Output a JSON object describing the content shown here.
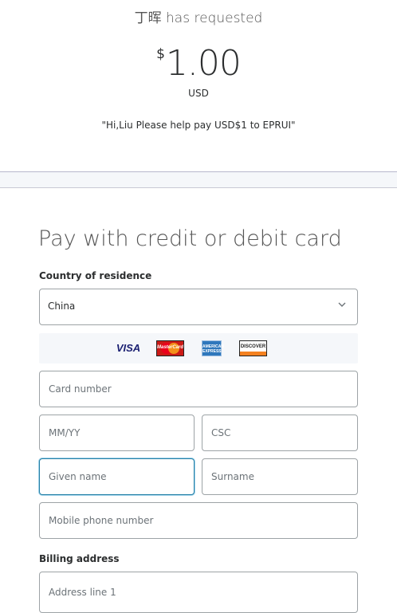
{
  "header": {
    "requester_text": "丁晖 has requested",
    "currency_symbol": "$",
    "amount": "1.00",
    "currency_code": "USD",
    "note": "\"Hi,Liu Please help pay USD$1 to EPRUI\""
  },
  "form": {
    "title": "Pay with credit or debit card",
    "country_label": "Country of residence",
    "country_value": "China",
    "card_brands": [
      "VISA",
      "MasterCard",
      "American Express",
      "DISCOVER"
    ],
    "card_number_placeholder": "Card number",
    "expiry_placeholder": "MM/YY",
    "csc_placeholder": "CSC",
    "given_name_placeholder": "Given name",
    "surname_placeholder": "Surname",
    "phone_placeholder": "Mobile phone number",
    "billing_label": "Billing address",
    "address_line1_placeholder": "Address line 1"
  },
  "colors": {
    "focus_border": "#2580a6",
    "divider_bg": "#f5f7fa"
  }
}
